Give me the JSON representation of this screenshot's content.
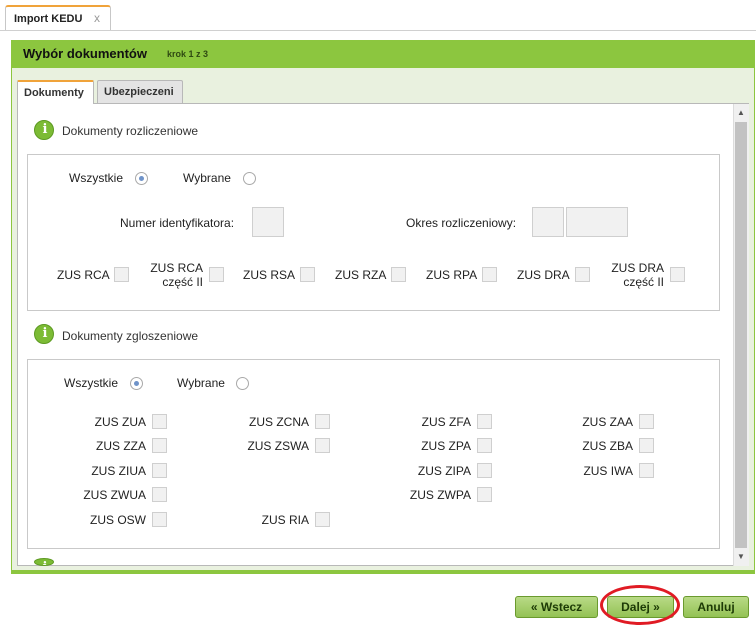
{
  "tab": {
    "title": "Import KEDU",
    "close": "x"
  },
  "window": {
    "title": "Wybór dokumentów",
    "step": "krok 1 z 3"
  },
  "inner_tabs": [
    "Dokumenty",
    "Ubezpieczeni"
  ],
  "section1": {
    "title": "Dokumenty rozliczeniowe",
    "radio_all": "Wszystkie",
    "radio_selected": "Wybrane",
    "id_label": "Numer identyfikatora:",
    "period_label": "Okres rozliczeniowy:",
    "docs": [
      {
        "line1": "ZUS RCA",
        "line2": ""
      },
      {
        "line1": "ZUS RCA",
        "line2": "część II"
      },
      {
        "line1": "ZUS RSA",
        "line2": ""
      },
      {
        "line1": "ZUS RZA",
        "line2": ""
      },
      {
        "line1": "ZUS RPA",
        "line2": ""
      },
      {
        "line1": "ZUS DRA",
        "line2": ""
      },
      {
        "line1": "ZUS DRA",
        "line2": "część II"
      }
    ]
  },
  "section2": {
    "title": "Dokumenty zgloszeniowe",
    "radio_all": "Wszystkie",
    "radio_selected": "Wybrane",
    "col1": [
      "ZUS ZUA",
      "ZUS ZZA",
      "ZUS ZIUA",
      "ZUS ZWUA",
      "ZUS OSW"
    ],
    "col2": [
      "ZUS ZCNA",
      "ZUS ZSWA",
      "ZUS RIA"
    ],
    "col3": [
      "ZUS ZFA",
      "ZUS ZPA",
      "ZUS ZIPA",
      "ZUS ZWPA"
    ],
    "col4": [
      "ZUS ZAA",
      "ZUS ZBA",
      "ZUS IWA"
    ]
  },
  "buttons": {
    "back": "« Wstecz",
    "next": "Dalej »",
    "cancel": "Anuluj"
  },
  "colors": {
    "accent_green": "#8cc63f",
    "tab_orange": "#f0a33a",
    "highlight_red": "#e01b24"
  }
}
